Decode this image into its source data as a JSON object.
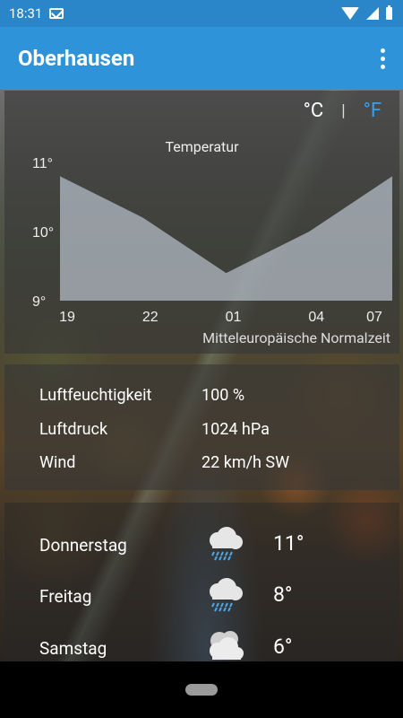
{
  "status_bar": {
    "time": "18:31",
    "icons": [
      "mail-icon",
      "wifi-icon",
      "signal-icon",
      "battery-icon"
    ]
  },
  "app_bar": {
    "title": "Oberhausen",
    "menu_icon": "more-vert-icon"
  },
  "units": {
    "celsius": "°C",
    "separator": "|",
    "fahrenheit": "°F",
    "active": "fahrenheit",
    "active_color": "#3aa0e6"
  },
  "chart": {
    "title": "Temperatur",
    "timezone": "Mitteleuropäische Normalzeit"
  },
  "chart_data": {
    "type": "area",
    "title": "Temperatur",
    "xlabel": "",
    "ylabel": "",
    "x": [
      "19",
      "22",
      "01",
      "04",
      "07"
    ],
    "y_ticks": [
      "11°",
      "10°",
      "9°"
    ],
    "ylim": [
      9,
      11
    ],
    "series": [
      {
        "values": [
          10.8,
          10.2,
          9.4,
          10.0,
          10.8
        ]
      }
    ],
    "grid": false
  },
  "details": [
    {
      "label": "Luftfeuchtigkeit",
      "value": "100 %"
    },
    {
      "label": "Luftdruck",
      "value": "1024 hPa"
    },
    {
      "label": "Wind",
      "value": "22 km/h SW"
    }
  ],
  "forecast": [
    {
      "day": "Donnerstag",
      "icon": "rain-cloud-icon",
      "temp": "11°"
    },
    {
      "day": "Freitag",
      "icon": "rain-cloud-icon",
      "temp": "8°"
    },
    {
      "day": "Samstag",
      "icon": "cloudy-icon",
      "temp": "6°"
    }
  ]
}
